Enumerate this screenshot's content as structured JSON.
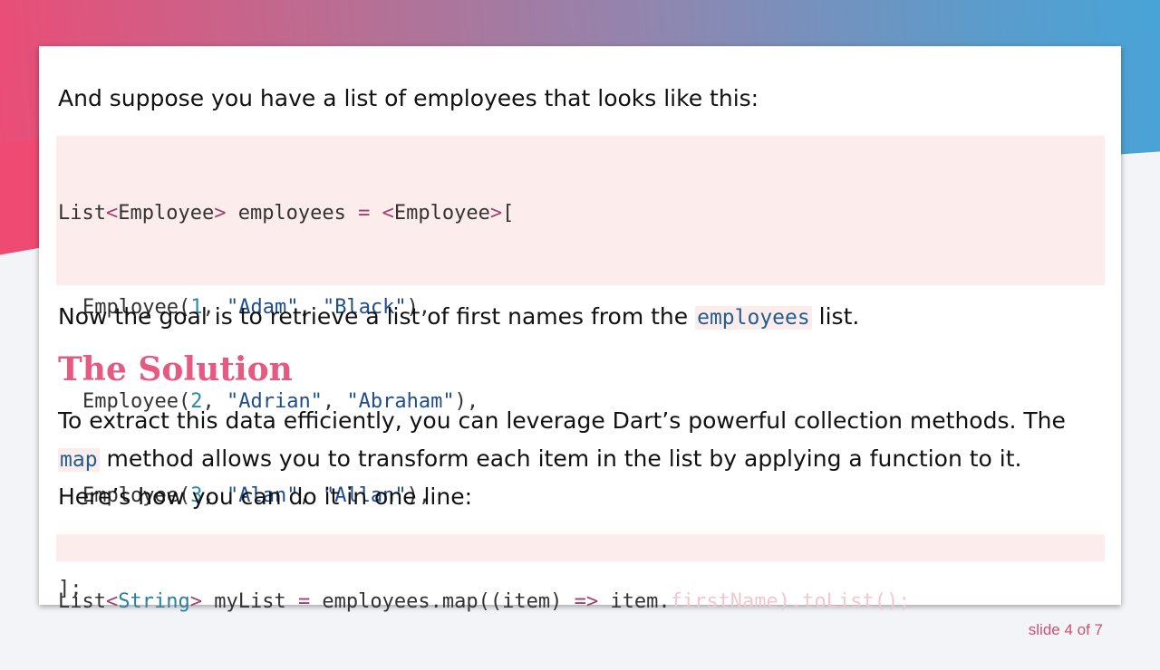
{
  "intro_text": "And suppose you have a list of employees that looks like this:",
  "code1": {
    "line1": {
      "a": "List",
      "b": "<",
      "c": "Employee",
      "d": ">",
      "e": " employees ",
      "f": "=",
      "g": " ",
      "h": "<",
      "i": "Employee",
      "j": ">",
      "k": "["
    },
    "rows": [
      {
        "pre": "Employee(",
        "num": "1",
        "sep1": ", ",
        "s1": "\"Adam\"",
        "sep2": ", ",
        "s2": "\"Black\"",
        "post": "),"
      },
      {
        "pre": "Employee(",
        "num": "2",
        "sep1": ", ",
        "s1": "\"Adrian\"",
        "sep2": ", ",
        "s2": "\"Abraham\"",
        "post": "),"
      },
      {
        "pre": "Employee(",
        "num": "3",
        "sep1": ", ",
        "s1": "\"Alan\"",
        "sep2": ", ",
        "s2": "\"Allan\"",
        "post": "),"
      }
    ],
    "closing": "];"
  },
  "goal_text": {
    "before": "Now the goal is to retrieve a list of first names from the ",
    "code": "employees",
    "after": " list."
  },
  "heading": "The Solution",
  "solution_text": {
    "line1": "To extract this data efficiently, you can leverage Dart’s powerful collection methods. The",
    "line2_code": "map",
    "line2_rest": " method allows you to transform each item in the list by applying a function to it.",
    "line3": "Here’s how you can do it in one line:"
  },
  "code2": {
    "a": "List",
    "b": "<",
    "c": "String",
    "d": ">",
    "e": " myList ",
    "f": "=",
    "g": " employees.map((item) ",
    "h": "=>",
    "i": " item.",
    "faded": "firstName).toList();"
  },
  "slide_counter": "slide 4 of 7",
  "colors": {
    "heading": "#e45a80",
    "code_bg": "#fdecec",
    "string": "#1f4d8c",
    "number": "#2a8aa8"
  }
}
